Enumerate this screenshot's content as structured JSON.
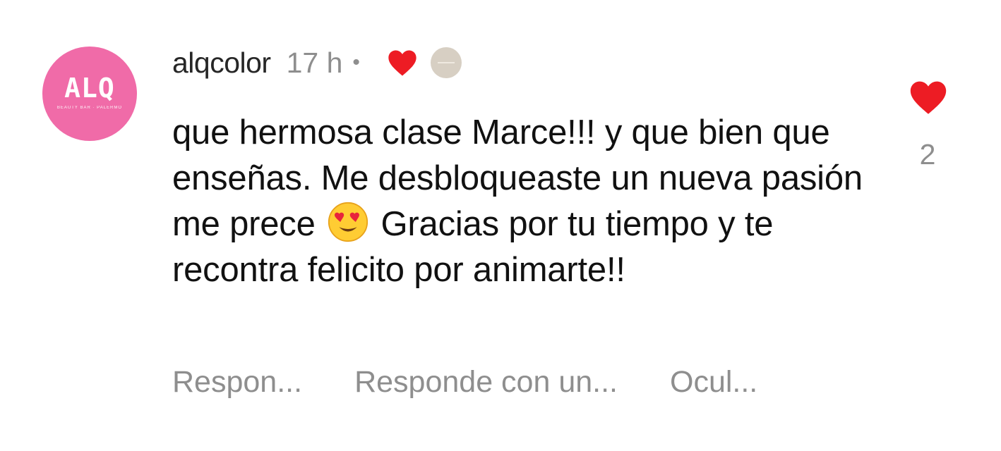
{
  "comment": {
    "avatar": {
      "logo_text": "ALQ",
      "logo_tagline": "BEAUTY BAR · PALERMO",
      "color": "#f06ba8"
    },
    "username": "alqcolor",
    "time": "17 h",
    "separator": "•",
    "creator_liked_icon": "heart-icon",
    "text_before_emoji": "que hermosa clase Marce!!! y que bien que enseñas. Me desbloqueaste un nueva pasión me prece ",
    "emoji": "smiling-face-with-heart-eyes",
    "text_after_emoji": " Gracias por tu tiempo y te recontra felicito por animarte!!",
    "likes": {
      "icon": "heart-icon",
      "count": "2",
      "color": "#ed1c24"
    },
    "actions": {
      "reply": "Respon...",
      "reply_with": "Responde con un...",
      "hide": "Ocul..."
    }
  }
}
